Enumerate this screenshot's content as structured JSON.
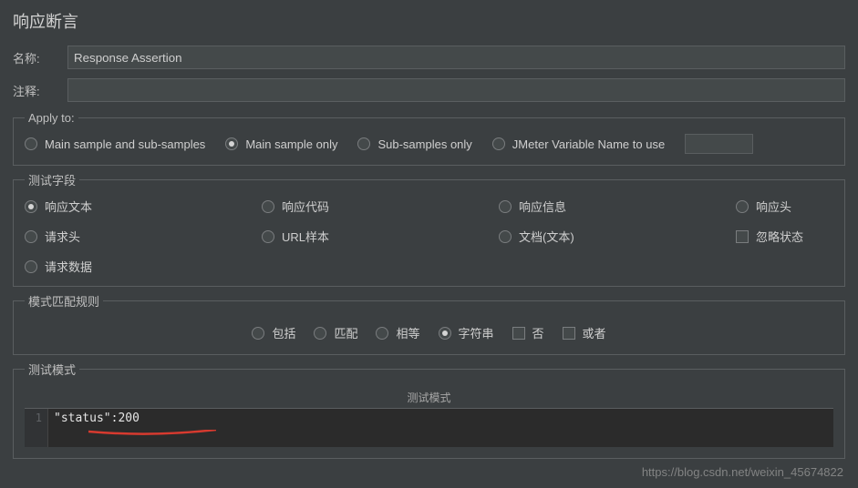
{
  "header": {
    "title": "响应断言"
  },
  "fields": {
    "name_label": "名称:",
    "name_value": "Response Assertion",
    "comment_label": "注释:",
    "comment_value": ""
  },
  "apply_to": {
    "legend": "Apply to:",
    "options": [
      {
        "label": "Main sample and sub-samples",
        "selected": false
      },
      {
        "label": "Main sample only",
        "selected": true
      },
      {
        "label": "Sub-samples only",
        "selected": false
      },
      {
        "label": "JMeter Variable Name to use",
        "selected": false
      }
    ],
    "var_value": ""
  },
  "test_field": {
    "legend": "测试字段",
    "options": [
      {
        "label": "响应文本",
        "selected": true
      },
      {
        "label": "响应代码",
        "selected": false
      },
      {
        "label": "响应信息",
        "selected": false
      },
      {
        "label": "响应头",
        "selected": false
      },
      {
        "label": "请求头",
        "selected": false
      },
      {
        "label": "URL样本",
        "selected": false
      },
      {
        "label": "文档(文本)",
        "selected": false
      }
    ],
    "ignore_status_label": "忽略状态",
    "request_data_label": "请求数据"
  },
  "match_rule": {
    "legend": "模式匹配规则",
    "options": [
      {
        "label": "包括",
        "selected": false
      },
      {
        "label": "匹配",
        "selected": false
      },
      {
        "label": "相等",
        "selected": false
      },
      {
        "label": "字符串",
        "selected": true
      }
    ],
    "not_label": "否",
    "or_label": "或者"
  },
  "test_pattern": {
    "legend": "测试模式",
    "column_header": "测试模式",
    "line_number": "1",
    "code_text": "\"status\":200"
  },
  "watermark": "https://blog.csdn.net/weixin_45674822"
}
